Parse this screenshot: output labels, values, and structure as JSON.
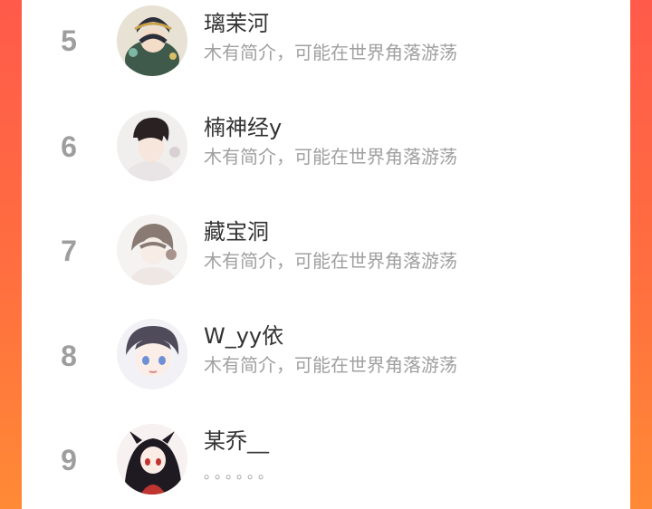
{
  "rankings": [
    {
      "rank": "5",
      "name": "璃茉河",
      "bio": "木有简介，可能在世界角落游荡"
    },
    {
      "rank": "6",
      "name": "楠神经y",
      "bio": "木有简介，可能在世界角落游荡"
    },
    {
      "rank": "7",
      "name": "藏宝洞",
      "bio": "木有简介，可能在世界角落游荡"
    },
    {
      "rank": "8",
      "name": "W_yy依",
      "bio": "木有简介，可能在世界角落游荡"
    },
    {
      "rank": "9",
      "name": "某乔__",
      "bio": "。。。。。。"
    }
  ],
  "colors": {
    "background_gradient_top": "#ff5a4a",
    "background_gradient_bottom": "#ff8a35",
    "panel": "#ffffff",
    "rank_text": "#9e9e9e",
    "name_text": "#333333",
    "bio_text": "#a0a0a0"
  }
}
